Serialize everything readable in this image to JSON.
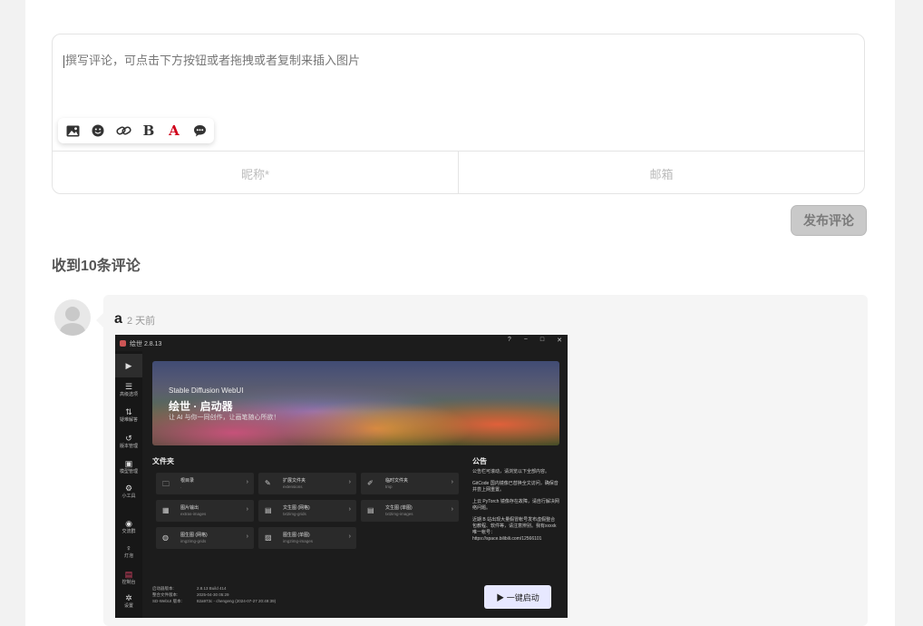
{
  "editor": {
    "placeholder": "撰写评论，可点击下方按钮或者拖拽或者复制来插入图片",
    "toolbar_icons": [
      "image-icon",
      "emoji-icon",
      "link-icon",
      "bold-icon",
      "font-color-icon",
      "comment-icon"
    ],
    "bold_label": "B",
    "color_label": "A",
    "font_color": "#d0021b",
    "nickname_placeholder": "昵称*",
    "email_placeholder": "邮箱"
  },
  "submit_label": "发布评论",
  "comments_title": "收到10条评论",
  "comment": {
    "author": "a",
    "time": "2 天前",
    "screenshot": {
      "app_title": "绘世 2.8.13",
      "window_buttons": [
        "?",
        "−",
        "□",
        "✕"
      ],
      "sidebar": [
        {
          "icon": "▶",
          "label": ""
        },
        {
          "icon": "☰",
          "label": "高级选项"
        },
        {
          "icon": "⇅",
          "label": "疑难解答"
        },
        {
          "icon": "↺",
          "label": "版本管理"
        },
        {
          "icon": "▣",
          "label": "模型管理"
        },
        {
          "icon": "⚙",
          "label": "小工具"
        },
        {
          "icon": "◉",
          "label": "交流群"
        },
        {
          "icon": "♀",
          "label": "灯泡"
        },
        {
          "icon": "▤",
          "label": "控制台"
        },
        {
          "icon": "✲",
          "label": "设置"
        }
      ],
      "banner_sub": "Stable Diffusion WebUI",
      "banner_title": "绘世 · 启动器",
      "banner_slogan": "让 AI 与你一同创作，让画笔随心所欲！",
      "folders_title": "文件夹",
      "folders": [
        {
          "name": "根目录",
          "path": "."
        },
        {
          "name": "扩展文件夹",
          "path": "extensions"
        },
        {
          "name": "临时文件夹",
          "path": "tmp"
        },
        {
          "name": "图片输出",
          "path": "extras-images"
        },
        {
          "name": "文生图 (网格)",
          "path": "txt2img-grids"
        },
        {
          "name": "文生图 (单图)",
          "path": "txt2img-images"
        },
        {
          "name": "图生图 (网格)",
          "path": "img2img-grids"
        },
        {
          "name": "图生图 (单图)",
          "path": "img2img-images"
        }
      ],
      "notice_title": "公告",
      "notice_lines": [
        "公告栏可滚动，请浏览以下全部内容。",
        "GitCode 国内镜像已替换全文访问，确保音并尝上网重置。",
        "上云 PyTorch 镜像存在故障，请自行解决网络问题。",
        "近期 B 站出现大量假冒帐号发布虚假整合包教程、软件等，请注意辨别。我有xxxxk 唯一帐号：https://space.bilibili.com/12566101"
      ],
      "version_labels": [
        "启动器版本:",
        "整合文件版本:",
        "SD-WebUI 版本:"
      ],
      "version_values": [
        "2.8.13 Build 414",
        "2025-04-30 05:29",
        "82a973c - chengeng (2024-07-27 20:49:39)"
      ],
      "launch_label": "▶ 一键启动"
    }
  }
}
